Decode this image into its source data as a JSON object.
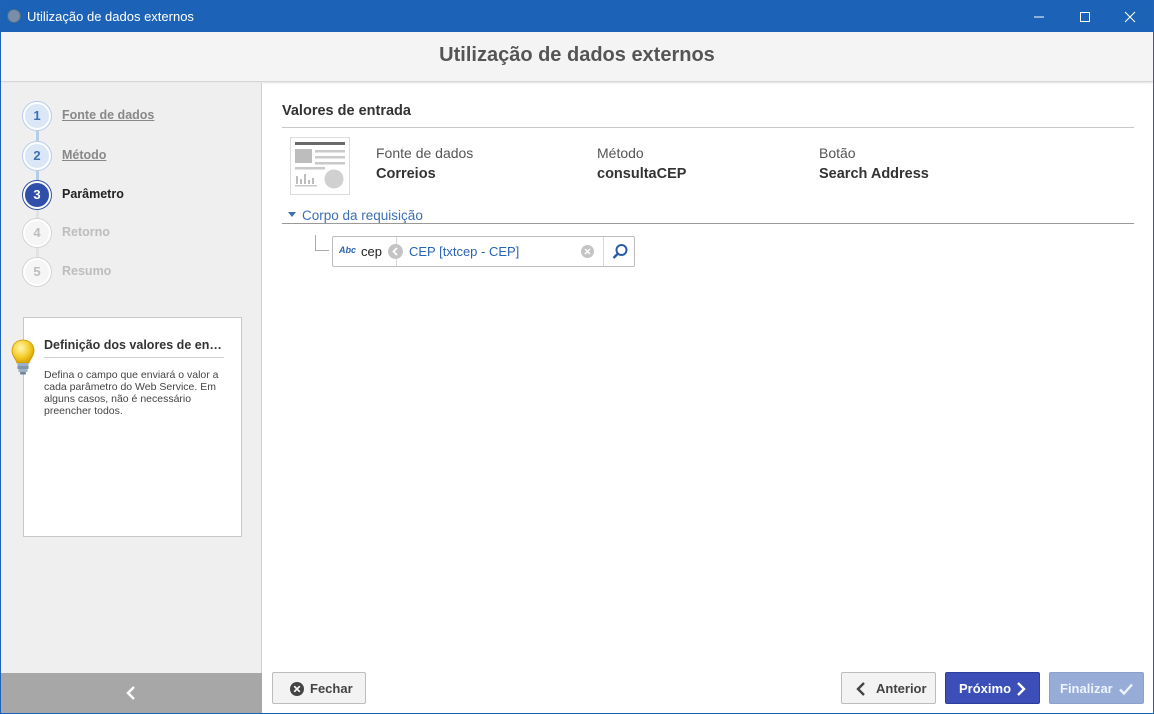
{
  "window": {
    "title": "Utilização de dados externos"
  },
  "header": {
    "title": "Utilização de dados externos"
  },
  "steps": [
    {
      "number": "1",
      "label": "Fonte de dados",
      "state": "done"
    },
    {
      "number": "2",
      "label": "Método",
      "state": "done"
    },
    {
      "number": "3",
      "label": "Parâmetro",
      "state": "active"
    },
    {
      "number": "4",
      "label": "Retorno",
      "state": "todo"
    },
    {
      "number": "5",
      "label": "Resumo",
      "state": "todo"
    }
  ],
  "hint": {
    "title": "Definição dos valores de entr...",
    "text": "Defina o campo que enviará o valor a cada parâmetro do Web Service. Em alguns casos, não é necessário preencher todos."
  },
  "main": {
    "section_title": "Valores de entrada",
    "info": {
      "source_key": "Fonte de dados",
      "source_value": "Correios",
      "method_key": "Método",
      "method_value": "consultaCEP",
      "button_key": "Botão",
      "button_value": "Search Address"
    },
    "group_label": "Corpo da requisição",
    "param": {
      "type_badge": "Abc",
      "name": "cep",
      "value": "CEP [txtcep - CEP]"
    }
  },
  "footer": {
    "close_label": "Fechar",
    "prev_label": "Anterior",
    "next_label": "Próximo",
    "finish_label": "Finalizar"
  },
  "colors": {
    "titlebar": "#1c63b7",
    "accent": "#3c4fb8",
    "link": "#3c6fb5"
  }
}
